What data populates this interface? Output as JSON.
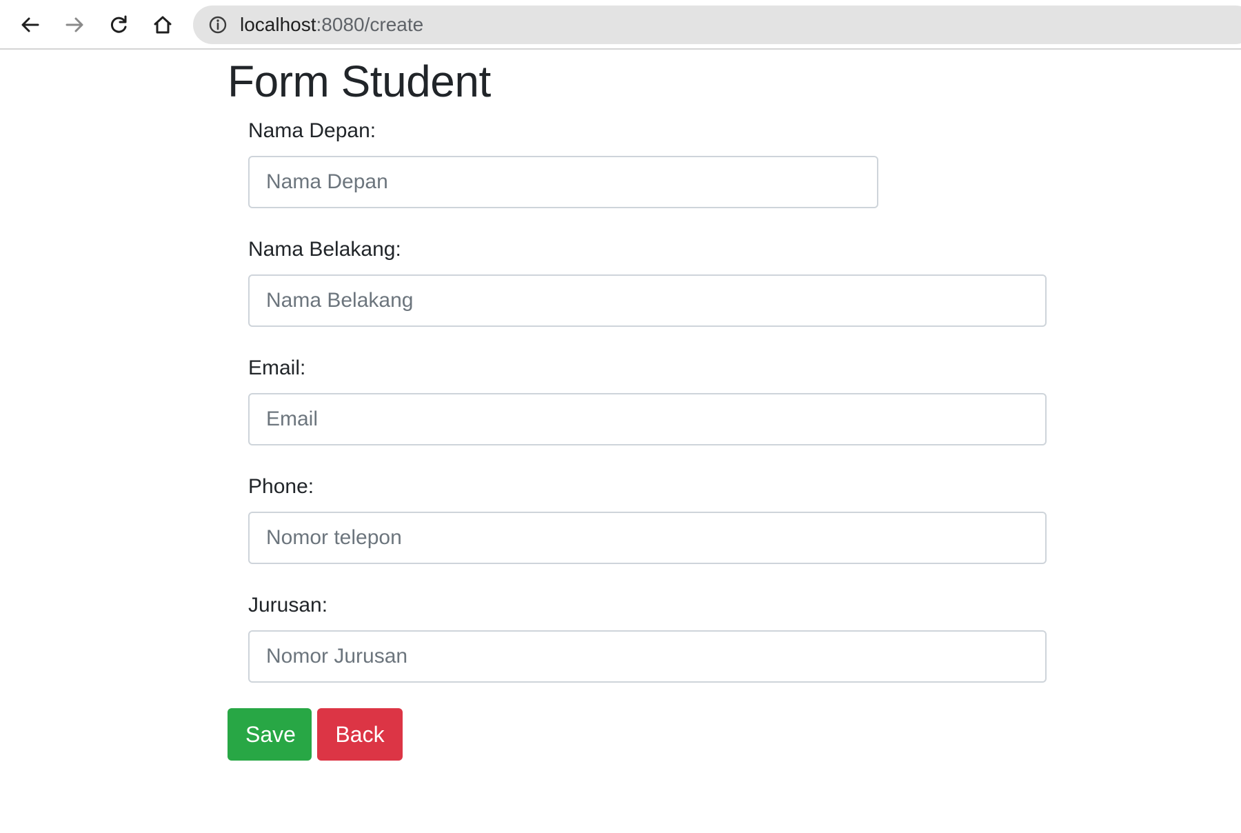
{
  "browser": {
    "url_host": "localhost",
    "url_rest": ":8080/create"
  },
  "page": {
    "title": "Form Student"
  },
  "form": {
    "fields": [
      {
        "label": "Nama Depan:",
        "placeholder": "Nama Depan",
        "value": ""
      },
      {
        "label": "Nama Belakang:",
        "placeholder": "Nama Belakang",
        "value": ""
      },
      {
        "label": "Email:",
        "placeholder": "Email",
        "value": ""
      },
      {
        "label": "Phone:",
        "placeholder": "Nomor telepon",
        "value": ""
      },
      {
        "label": "Jurusan:",
        "placeholder": "Nomor Jurusan",
        "value": ""
      }
    ],
    "save_label": "Save",
    "back_label": "Back"
  },
  "colors": {
    "save": "#28a745",
    "back": "#dc3545",
    "input_border": "#ced4da",
    "placeholder": "#6c757d",
    "address_bar": "#e3e3e3"
  },
  "icons": {
    "back": "arrow-left-icon",
    "forward": "arrow-right-icon",
    "reload": "reload-icon",
    "home": "home-icon",
    "info": "info-icon"
  }
}
